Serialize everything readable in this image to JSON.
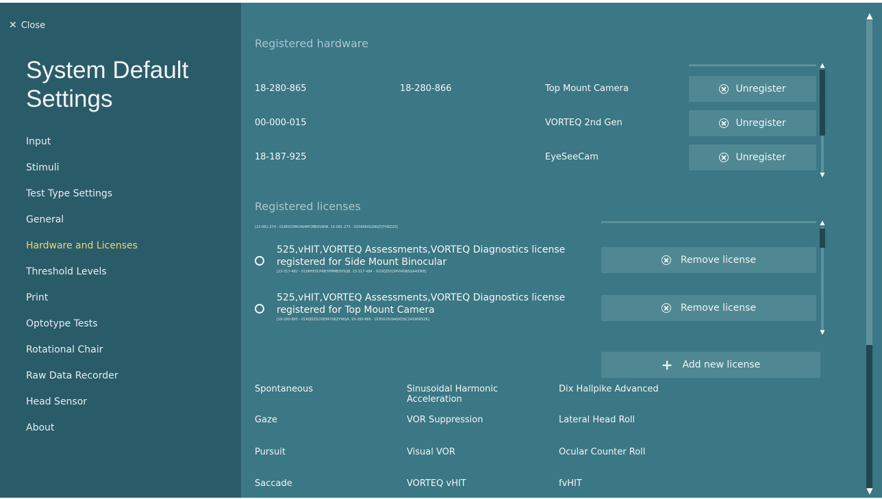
{
  "window": {
    "close_label": "Close",
    "title": "System Default Settings"
  },
  "sidebar": {
    "items": [
      {
        "label": "Input"
      },
      {
        "label": "Stimuli"
      },
      {
        "label": "Test Type Settings"
      },
      {
        "label": "General"
      },
      {
        "label": "Hardware and Licenses",
        "active": true
      },
      {
        "label": "Threshold Levels"
      },
      {
        "label": "Print"
      },
      {
        "label": "Optotype Tests"
      },
      {
        "label": "Rotational Chair"
      },
      {
        "label": "Raw Data Recorder"
      },
      {
        "label": "Head Sensor"
      },
      {
        "label": "About"
      }
    ]
  },
  "hardware": {
    "section_title": "Registered hardware",
    "rows": [
      {
        "serial1": "18-280-865",
        "serial2": "18-280-866",
        "device": "Top Mount Camera",
        "button": "Unregister"
      },
      {
        "serial1": "00-000-015",
        "serial2": "",
        "device": "VORTEQ 2nd Gen",
        "button": "Unregister"
      },
      {
        "serial1": "18-187-925",
        "serial2": "",
        "device": "EyeSeeCam",
        "button": "Unregister"
      }
    ]
  },
  "licenses": {
    "section_title": "Registered licenses",
    "top_partial_key": "[23-081-274 - 0180025MOIW4PCMBDVWW, 15-081-275 - 0109060S2NUJ7J7H6Z20]",
    "items": [
      {
        "text": "525,vHIT,VORTEQ Assessments,VORTEQ Diagnostics license registered for Side Mount Binocular",
        "key": "[23-317-482 - 0108HESCPRB7PMMB3VSQB, 23-317-484 - 01DQZ5I1SPVI4SNSGA4ZW8]",
        "button": "Remove license"
      },
      {
        "text": "525,vHIT,VORTEQ Assessments,VORTEQ Diagnostics license registered for Top Mount Camera",
        "key": "[18-280-865 - 0160J0Z5I2VEPA7S6ZYWQA, 18-280-866 - 018SGI3U9A0XDSC2ASWWSZ6]",
        "button": "Remove license"
      }
    ],
    "add_button": "Add new license"
  },
  "tests": [
    [
      "Spontaneous",
      "Sinusoidal Harmonic Acceleration",
      "Dix Hallpike Advanced"
    ],
    [
      "Gaze",
      "VOR Suppression",
      "Lateral Head Roll"
    ],
    [
      "Pursuit",
      "Visual VOR",
      "Ocular Counter Roll"
    ],
    [
      "Saccade",
      "VORTEQ vHIT",
      "fvHIT"
    ]
  ],
  "colors": {
    "sidebar_bg": "#2a5b69",
    "main_bg": "#3b7784",
    "button_bg": "#4f8893",
    "active_nav": "#e9d774"
  },
  "icons": {
    "close": "close-icon",
    "unregister": "circle-x-icon",
    "remove": "circle-x-icon",
    "add": "plus-icon"
  }
}
